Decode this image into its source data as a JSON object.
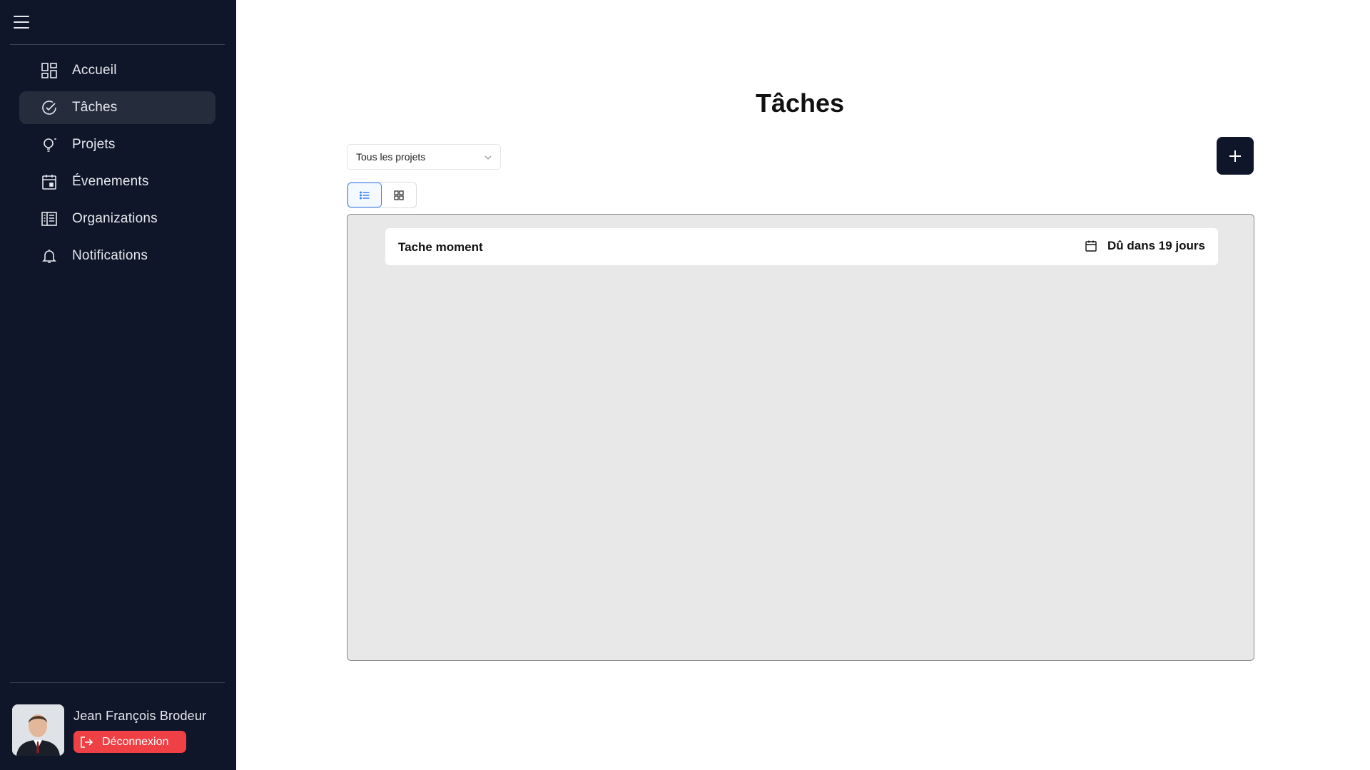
{
  "sidebar": {
    "items": [
      {
        "label": "Accueil",
        "icon": "dashboard-icon",
        "active": false
      },
      {
        "label": "Tâches",
        "icon": "check-circle-icon",
        "active": true
      },
      {
        "label": "Projets",
        "icon": "lightbulb-icon",
        "active": false
      },
      {
        "label": "Évenements",
        "icon": "calendar-icon",
        "active": false
      },
      {
        "label": "Organizations",
        "icon": "building-icon",
        "active": false
      },
      {
        "label": "Notifications",
        "icon": "bell-icon",
        "active": false
      }
    ],
    "user": {
      "name": "Jean François Brodeur",
      "logout_label": "Déconnexion"
    }
  },
  "main": {
    "title": "Tâches",
    "project_filter": {
      "value": "Tous les projets"
    },
    "view_mode": "list",
    "tasks": [
      {
        "title": "Tache moment",
        "due": "Dû dans 19 jours"
      }
    ]
  },
  "colors": {
    "sidebar_bg": "#0f1629",
    "active_item_bg": "#252d3d",
    "logout_red": "#ef4045",
    "toggle_accent": "#3b82f6",
    "panel_bg": "#e8e8e8"
  }
}
